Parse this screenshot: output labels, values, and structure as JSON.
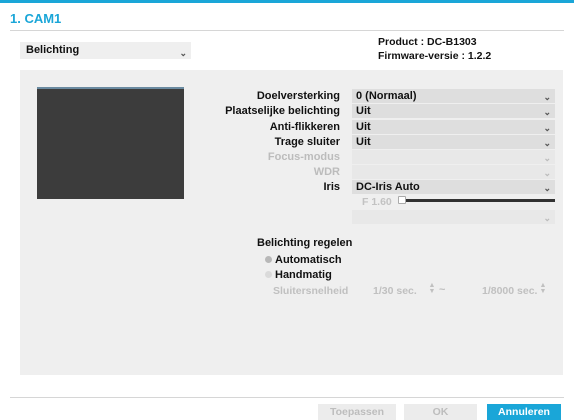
{
  "window": {
    "title": "1. CAM1"
  },
  "menu": {
    "selected": "Belichting"
  },
  "device": {
    "product": "Product : DC-B1303",
    "firmware": "Firmware-versie : 1.2.2"
  },
  "settings": {
    "gain_label": "Doelversterking",
    "gain_value": "0 (Normaal)",
    "local_label": "Plaatselijke belichting",
    "local_value": "Uit",
    "flicker_label": "Anti-flikkeren",
    "flicker_value": "Uit",
    "slow_label": "Trage sluiter",
    "slow_value": "Uit",
    "focus_label": "Focus-modus",
    "focus_value": "",
    "wdr_label": "WDR",
    "wdr_value": "",
    "iris_label": "Iris",
    "iris_value": "DC-Iris Auto",
    "fvalue": "F 1.60",
    "extra_value": ""
  },
  "exposure_control": {
    "heading": "Belichting regelen",
    "auto_label": "Automatisch",
    "manual_label": "Handmatig",
    "selected": "Automatisch",
    "shutter_label": "Sluitersnelheid",
    "shutter_min": "1/30 sec.",
    "shutter_max": "1/8000 sec.",
    "separator": "~"
  },
  "buttons": {
    "apply": "Toepassen",
    "ok": "OK",
    "cancel": "Annuleren"
  },
  "colors": {
    "accent": "#1aa6d8",
    "panel": "#efefef",
    "preview": "#3c3c3c"
  }
}
